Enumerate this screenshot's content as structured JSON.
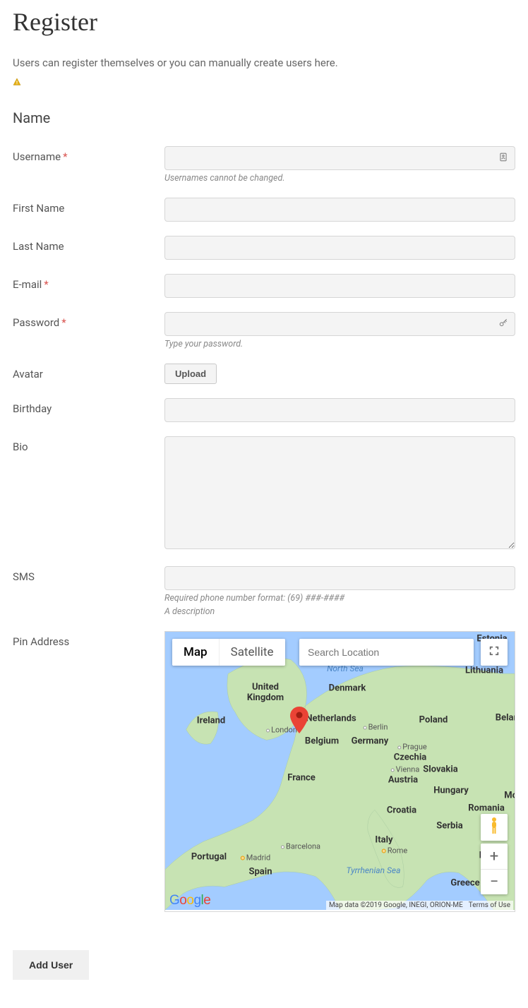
{
  "page": {
    "title": "Register",
    "subtitle": "Users can register themselves or you can manually create users here.",
    "section_name": "Name"
  },
  "fields": {
    "username": {
      "label": "Username",
      "required": true,
      "value": "",
      "hint": "Usernames cannot be changed."
    },
    "first_name": {
      "label": "First Name",
      "required": false,
      "value": ""
    },
    "last_name": {
      "label": "Last Name",
      "required": false,
      "value": ""
    },
    "email": {
      "label": "E-mail",
      "required": true,
      "value": ""
    },
    "password": {
      "label": "Password",
      "required": true,
      "value": "",
      "hint": "Type your password."
    },
    "avatar": {
      "label": "Avatar",
      "button": "Upload"
    },
    "birthday": {
      "label": "Birthday",
      "value": ""
    },
    "bio": {
      "label": "Bio",
      "value": ""
    },
    "sms": {
      "label": "SMS",
      "value": "",
      "hint1": "Required phone number format: (69) ###-####",
      "hint2": "A description"
    },
    "pin_address": {
      "label": "Pin Address"
    }
  },
  "map": {
    "tab_map": "Map",
    "tab_satellite": "Satellite",
    "search_placeholder": "Search Location",
    "attribution": "Map data ©2019 Google, INEGI, ORION-ME",
    "terms": "Terms of Use",
    "logo": "Google",
    "seas": {
      "north_sea": "North Sea",
      "tyrrhenian_sea": "Tyrrhenian Sea"
    },
    "countries": {
      "estonia": "Estonia",
      "lithuania": "Lithuania",
      "belarus": "Belarus",
      "uk": "United\nKingdom",
      "ireland": "Ireland",
      "denmark": "Denmark",
      "netherlands": "Netherlands",
      "poland": "Poland",
      "germany": "Germany",
      "belgium": "Belgium",
      "czechia": "Czechia",
      "slovakia": "Slovakia",
      "austria": "Austria",
      "france": "France",
      "hungary": "Hungary",
      "romania": "Romania",
      "moldova": "Mold",
      "croatia": "Croatia",
      "serbia": "Serbia",
      "italy": "Italy",
      "bulgaria": "Bulg",
      "portugal": "Portugal",
      "spain": "Spain",
      "greece": "Greece"
    },
    "cities": {
      "london": "London",
      "berlin": "Berlin",
      "prague": "Prague",
      "vienna": "Vienna",
      "madrid": "Madrid",
      "barcelona": "Barcelona",
      "rome": "Rome"
    }
  },
  "submit": {
    "label": "Add User"
  }
}
